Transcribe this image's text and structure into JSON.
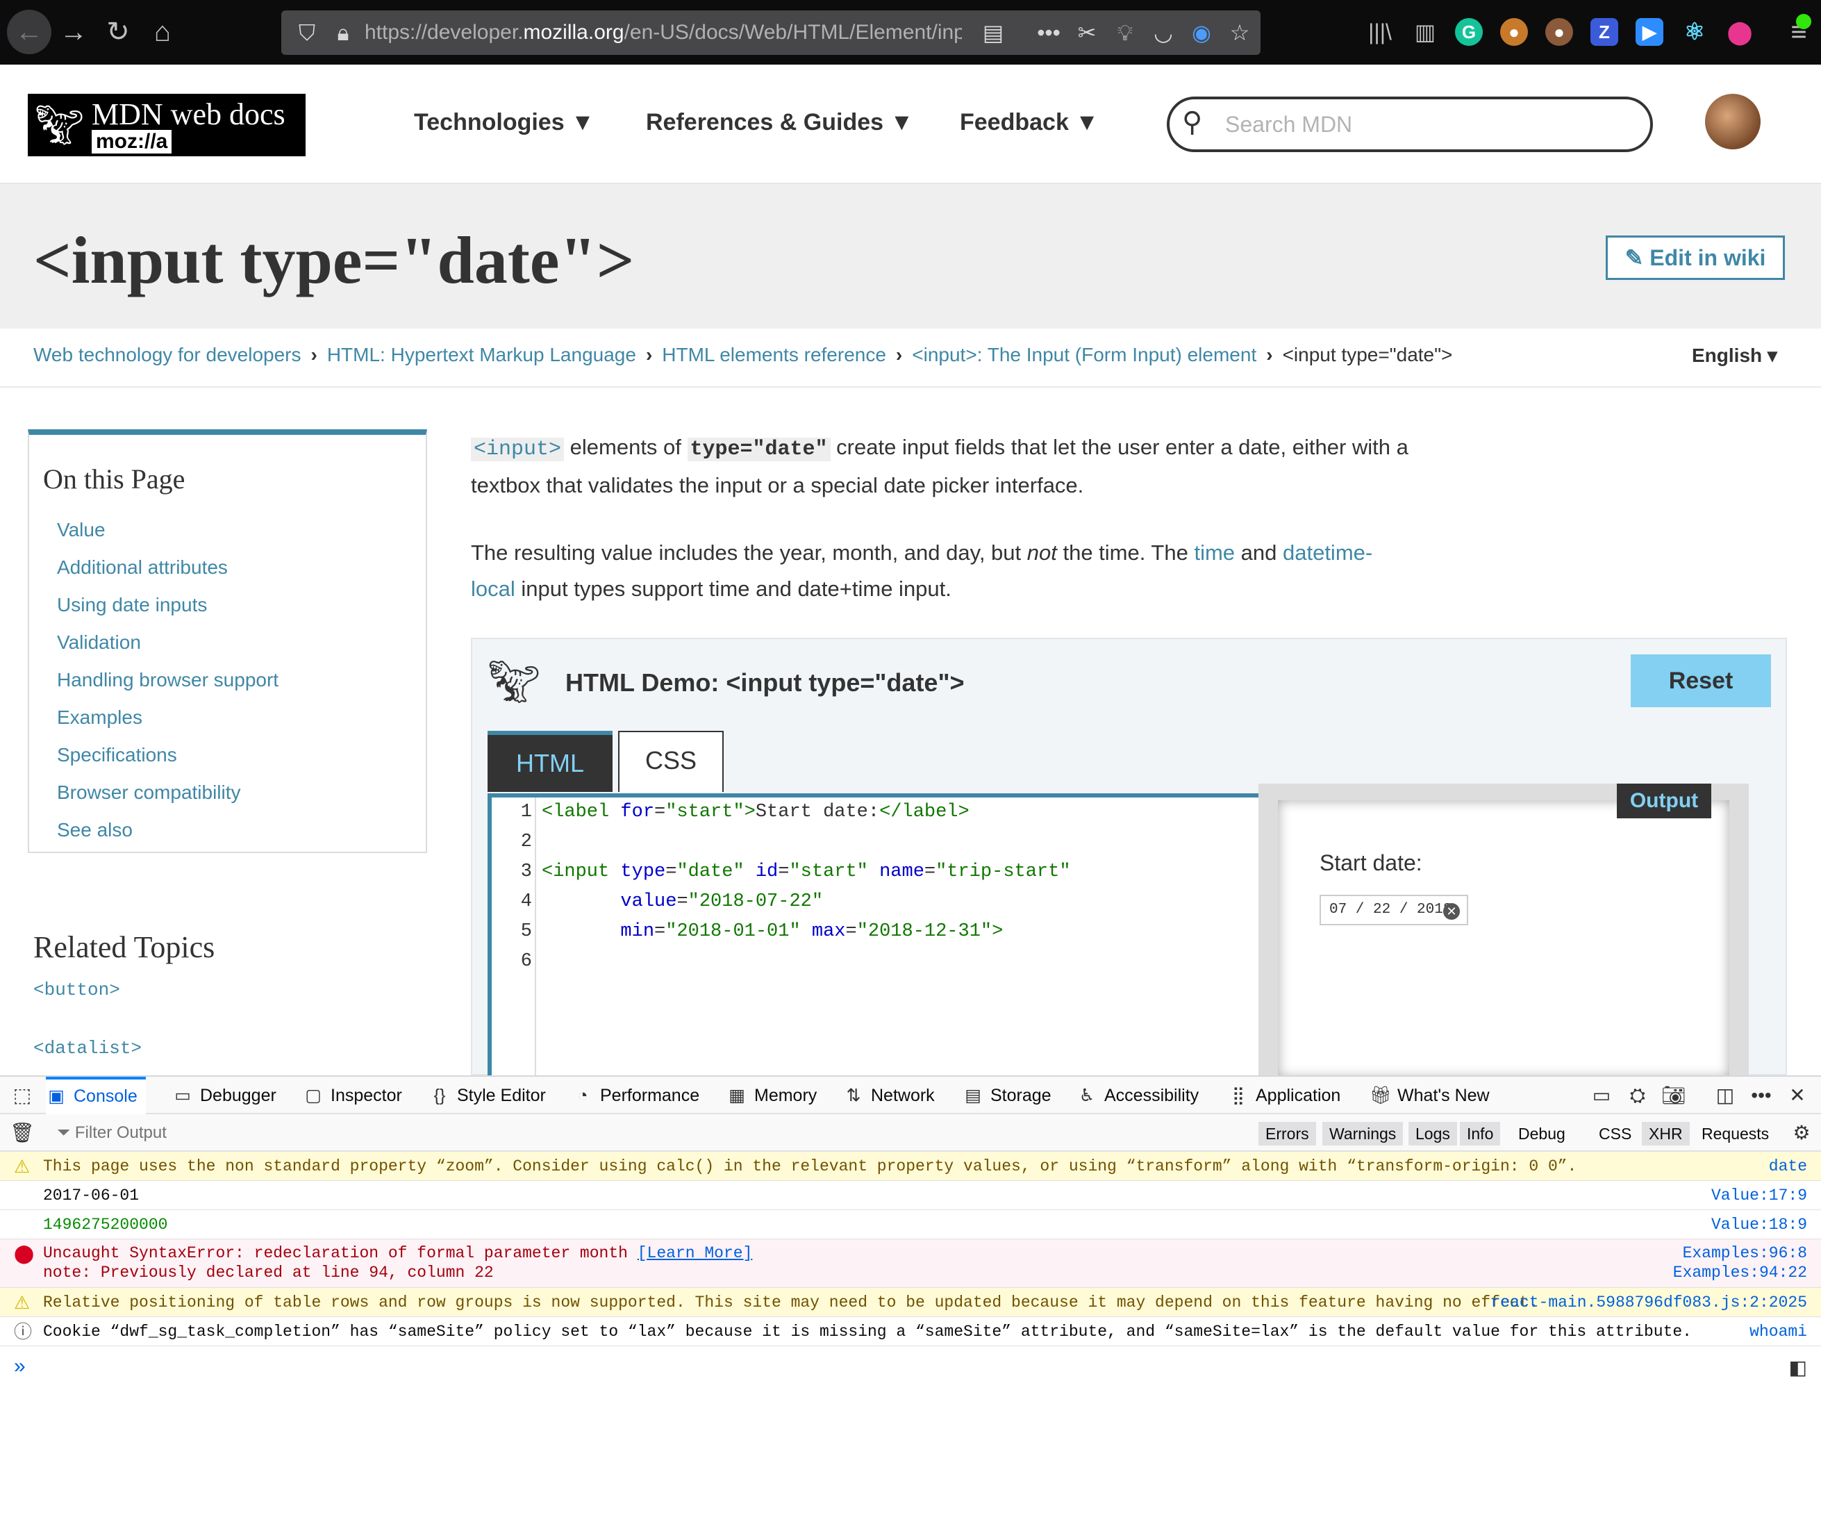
{
  "browser": {
    "url_prefix": "https://developer.",
    "url_domain": "mozilla.org",
    "url_path": "/en-US/docs/Web/HTML/Element/input/",
    "ext_z": "Z"
  },
  "header": {
    "logo_title": "MDN web docs",
    "logo_sub": "moz://a",
    "nav": [
      "Technologies ▼",
      "References & Guides ▼",
      "Feedback ▼"
    ],
    "search_placeholder": "Search MDN"
  },
  "page": {
    "title": "<input type=\"date\">",
    "edit_label": "Edit in wiki",
    "language": "English ▾"
  },
  "breadcrumbs": {
    "items": [
      "Web technology for developers",
      "HTML: Hypertext Markup Language",
      "HTML elements reference",
      "<input>: The Input (Form Input) element"
    ],
    "current": "<input type=\"date\">"
  },
  "toc": {
    "heading": "On this Page",
    "items": [
      "Value",
      "Additional attributes",
      "Using date inputs",
      "Validation",
      "Handling browser support",
      "Examples",
      "Specifications",
      "Browser compatibility",
      "See also"
    ]
  },
  "related": {
    "heading": "Related Topics",
    "items": [
      "<button>",
      "<datalist>"
    ]
  },
  "article": {
    "p1_code1": "<input>",
    "p1_text1": " elements of ",
    "p1_code2": "type=\"date\"",
    "p1_text2": " create input fields that let the user enter a date, either with a textbox that validates the input or a special date picker interface.",
    "p2_text1": "The resulting value includes the year, month, and day, but ",
    "p2_em": "not",
    "p2_text2": " the time. The ",
    "p2_link1": "time",
    "p2_text3": " and ",
    "p2_link2": "datetime-local",
    "p2_text4": " input types support time and date+time input."
  },
  "demo": {
    "title": "HTML Demo: <input type=\"date\">",
    "reset": "Reset",
    "tab_html": "HTML",
    "tab_css": "CSS",
    "line_numbers": [
      "1",
      "2",
      "3",
      "4",
      "5",
      "6"
    ],
    "output_label": "Output",
    "start_label": "Start date:",
    "date_value": "07 / 22 / 2018",
    "clear_glyph": "✕"
  },
  "devtools": {
    "tabs": [
      "Console",
      "Debugger",
      "Inspector",
      "Style Editor",
      "Performance",
      "Memory",
      "Network",
      "Storage",
      "Accessibility",
      "Application",
      "What's New"
    ],
    "filter_placeholder": "Filter Output",
    "filters": [
      "Errors",
      "Warnings",
      "Logs",
      "Info",
      "Debug",
      "CSS",
      "XHR",
      "Requests"
    ],
    "messages": [
      {
        "type": "warn",
        "text": "This page uses the non standard property “zoom”. Consider using calc() in the relevant property values, or using “transform” along with “transform-origin: 0 0”.",
        "source": "date"
      },
      {
        "type": "log",
        "text": "2017-06-01",
        "source": "Value:17:9"
      },
      {
        "type": "log-num",
        "text": "1496275200000",
        "source": "Value:18:9"
      },
      {
        "type": "error",
        "text": "Uncaught SyntaxError: redeclaration of formal parameter month ",
        "link": "[Learn More]",
        "text2": "note: Previously declared at line 94, column 22",
        "source": "Examples:96:8",
        "source2": "Examples:94:22"
      },
      {
        "type": "warn",
        "text": "Relative positioning of table rows and row groups is now supported. This site may need to be updated because it may depend on this feature having no effect.",
        "source": "react-main.5988796df083.js:2:2025"
      },
      {
        "type": "info",
        "text": "Cookie “dwf_sg_task_completion” has “sameSite” policy set to “lax” because it is missing a “sameSite” attribute, and “sameSite=lax” is the default value for this attribute.",
        "source": "whoami"
      }
    ]
  }
}
